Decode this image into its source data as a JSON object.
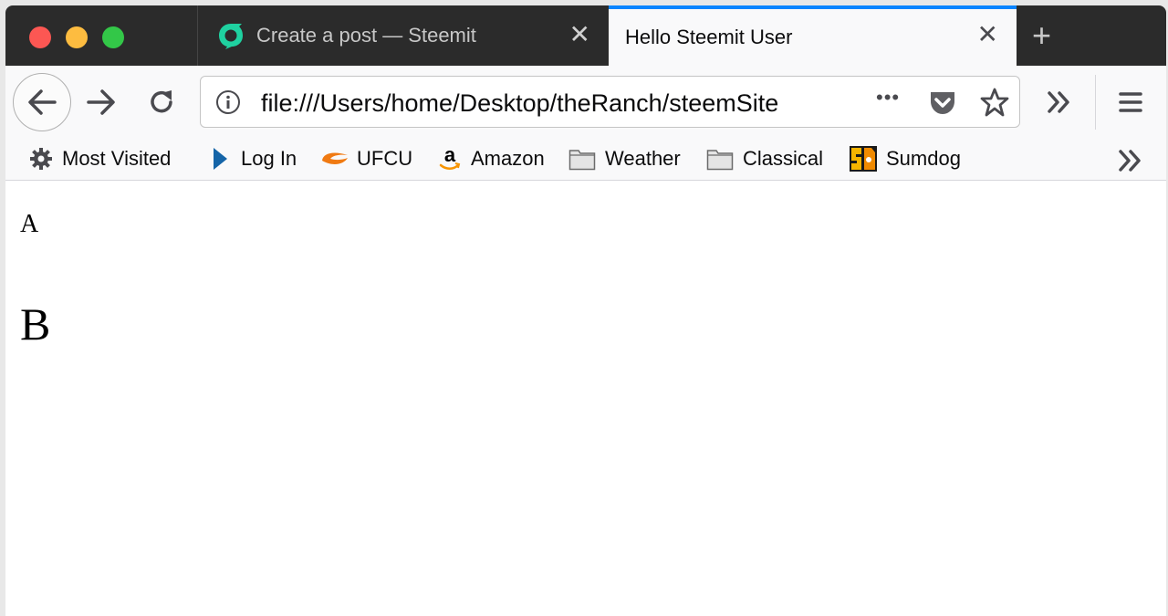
{
  "browser": {
    "window_controls": [
      "close",
      "minimize",
      "zoom"
    ],
    "tabs": [
      {
        "title": "Create a post — Steemit",
        "favicon": "steemit-logo-icon",
        "active": false,
        "close_label": "✕"
      },
      {
        "title": "Hello Steemit User",
        "active": true,
        "close_label": "✕"
      }
    ],
    "new_tab_label": "+",
    "accent_color": "#0a84ff",
    "toolbar": {
      "url": "file:///Users/home/Desktop/theRanch/steemSite",
      "page_actions_label": "•••"
    },
    "bookmarks": [
      {
        "label": "Most Visited",
        "icon": "gear-icon"
      },
      {
        "label": "Log In",
        "icon": "play-triangle-icon"
      },
      {
        "label": "UFCU",
        "icon": "ufcu-logo-icon"
      },
      {
        "label": "Amazon",
        "icon": "amazon-logo-icon"
      },
      {
        "label": "Weather",
        "icon": "folder-icon"
      },
      {
        "label": "Classical",
        "icon": "folder-icon"
      },
      {
        "label": "Sumdog",
        "icon": "sumdog-logo-icon"
      }
    ]
  },
  "page": {
    "heading_a": "A",
    "heading_b": "B"
  }
}
